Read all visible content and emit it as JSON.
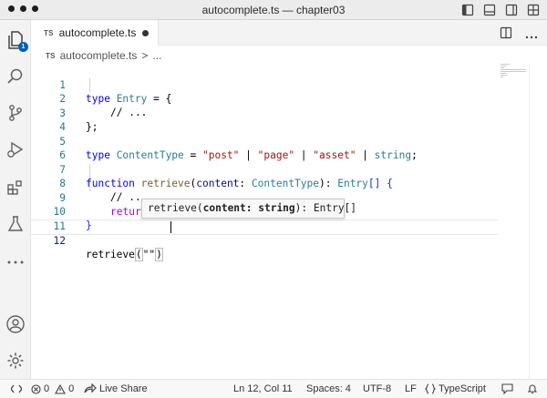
{
  "window": {
    "title": "autocomplete.ts — chapter03"
  },
  "activity_bar": {
    "explorer_badge": "1",
    "items": [
      "explorer",
      "search",
      "source-control",
      "run-and-debug",
      "extensions",
      "testing",
      "more",
      "accounts",
      "manage"
    ]
  },
  "tab": {
    "lang_badge": "TS",
    "name": "autocomplete.ts"
  },
  "breadcrumb": {
    "lang_badge": "TS",
    "file": "autocomplete.ts",
    "separator": ">",
    "more": "..."
  },
  "editor": {
    "lines": [
      {
        "num": "1"
      },
      {
        "num": "2"
      },
      {
        "num": "3"
      },
      {
        "num": "4"
      },
      {
        "num": "5"
      },
      {
        "num": "6"
      },
      {
        "num": "7"
      },
      {
        "num": "8"
      },
      {
        "num": "9"
      },
      {
        "num": "10"
      },
      {
        "num": "11"
      },
      {
        "num": "12"
      }
    ],
    "tokens": {
      "l1_type": "type",
      "l1_name": " Entry ",
      "l1_rest": "= {",
      "l2": "// ...",
      "l3": "};",
      "l5_type": "type",
      "l5_name": " ContentType ",
      "l5_eq": "= ",
      "l5_s1": "\"post\"",
      "l5_p1": " | ",
      "l5_s2": "\"page\"",
      "l5_p2": " | ",
      "l5_s3": "\"asset\"",
      "l5_p3": " | ",
      "l5_str": "string",
      "l5_end": ";",
      "l7_fn": "function",
      "l7_name": " retrieve",
      "l7_open": "(",
      "l7_param": "content",
      "l7_colon": ": ",
      "l7_ptype": "ContentType",
      "l7_close": "): ",
      "l7_ret": "Entry",
      "l7_arr": "[]",
      "l7_brace": " {",
      "l8": "// ...",
      "l9_kw": "return",
      "l9_val": " []",
      "l10": "}",
      "l12_call": "retrieve",
      "l12_open": "(",
      "l12_str": "\"\"",
      "l12_close": ")"
    }
  },
  "signature_hint": {
    "prefix": "retrieve(",
    "param": "content: string",
    "suffix": "): Entry[]"
  },
  "status_bar": {
    "errors": "0",
    "warnings": "0",
    "live_share": "Live Share",
    "position": "Ln 12, Col 11",
    "spaces": "Spaces: 4",
    "encoding": "UTF-8",
    "eol": "LF",
    "language": "TypeScript"
  }
}
